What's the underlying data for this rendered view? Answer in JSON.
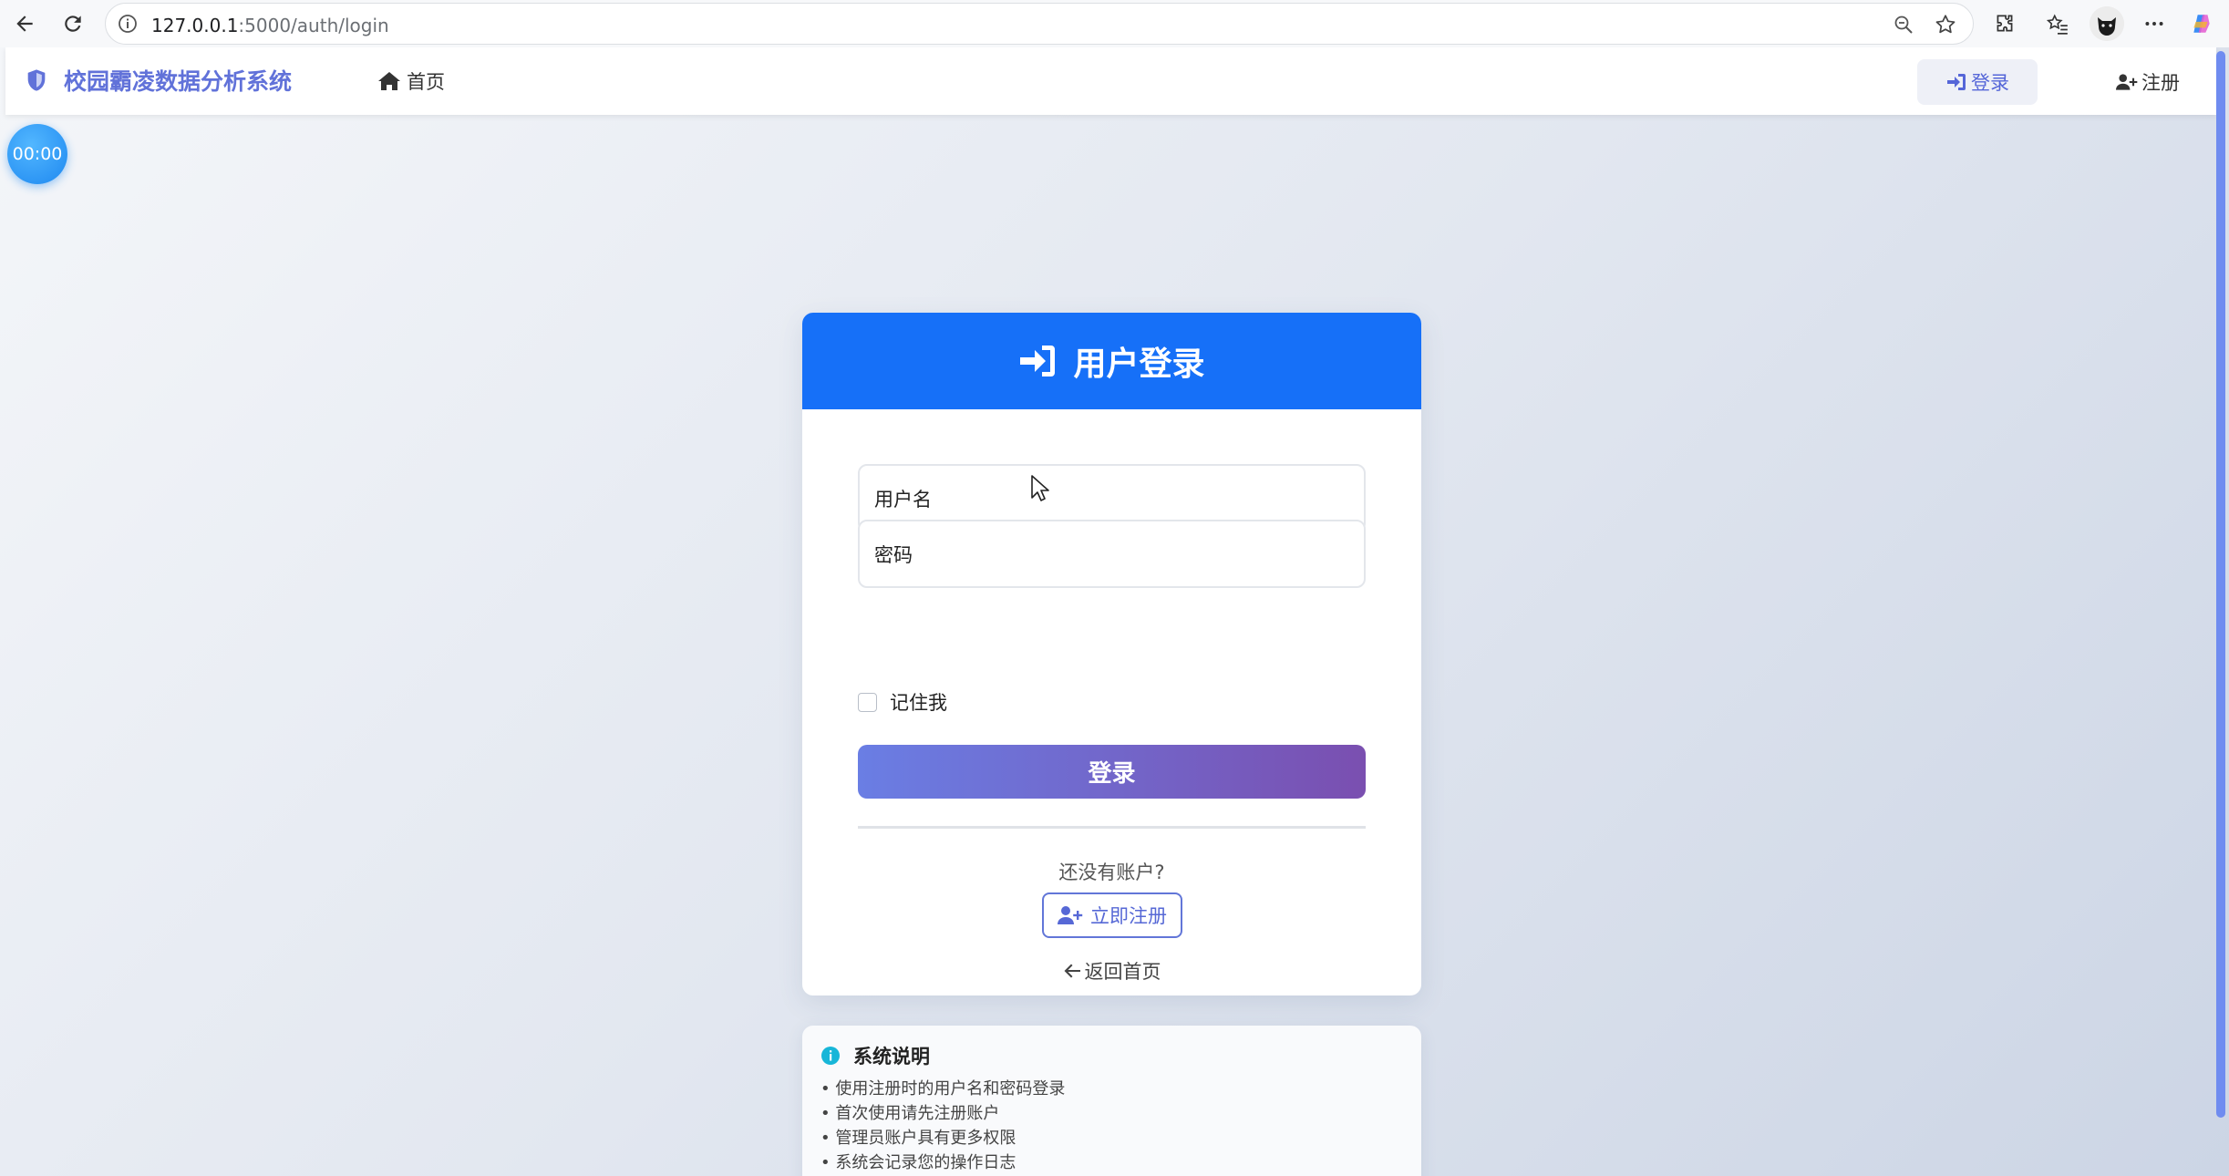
{
  "browser": {
    "url_host": "127.0.0.1",
    "url_path": ":5000/auth/login"
  },
  "navbar": {
    "brand": "校园霸凌数据分析系统",
    "home": "首页",
    "login": "登录",
    "register": "注册"
  },
  "timer": "00:00",
  "login_card": {
    "title": "用户登录",
    "username_placeholder": "用户名",
    "password_placeholder": "密码",
    "remember_me": "记住我",
    "submit": "登录",
    "no_account": "还没有账户?",
    "register_now": "立即注册",
    "back_home": "返回首页"
  },
  "info_card": {
    "title": "系统说明",
    "items": [
      "• 使用注册时的用户名和密码登录",
      "• 首次使用请先注册账户",
      "• 管理员账户具有更多权限",
      "• 系统会记录您的操作日志"
    ]
  },
  "colors": {
    "header_blue": "#1670f8",
    "brand_purple": "#6172d9",
    "button_gradient_start": "#6a7ee4",
    "button_gradient_end": "#7a4fb0"
  }
}
